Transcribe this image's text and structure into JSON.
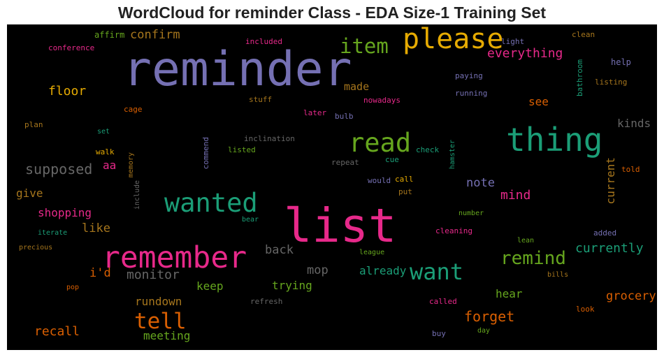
{
  "chart_data": {
    "type": "wordcloud",
    "title": "WordCloud for reminder Class - EDA Size-1 Training Set",
    "background": "#000000",
    "words": [
      {
        "text": "reminder",
        "color": "#7570b3"
      },
      {
        "text": "list",
        "color": "#e7298a"
      },
      {
        "text": "thing",
        "color": "#1b9e77"
      },
      {
        "text": "please",
        "color": "#e6ab02"
      },
      {
        "text": "remember",
        "color": "#e7298a"
      },
      {
        "text": "wanted",
        "color": "#1b9e77"
      },
      {
        "text": "read",
        "color": "#66a61e"
      },
      {
        "text": "want",
        "color": "#1b9e77"
      },
      {
        "text": "tell",
        "color": "#d95f02"
      },
      {
        "text": "item",
        "color": "#66a61e"
      },
      {
        "text": "remind",
        "color": "#66a61e"
      },
      {
        "text": "supposed",
        "color": "#666666"
      },
      {
        "text": "forget",
        "color": "#d95f02"
      },
      {
        "text": "currently",
        "color": "#1b9e77"
      },
      {
        "text": "grocery",
        "color": "#d95f02"
      },
      {
        "text": "everything",
        "color": "#e7298a"
      },
      {
        "text": "kinds",
        "color": "#666666"
      },
      {
        "text": "current",
        "color": "#a6761d"
      },
      {
        "text": "confirm",
        "color": "#a6761d"
      },
      {
        "text": "floor",
        "color": "#e6ab02"
      },
      {
        "text": "mind",
        "color": "#e7298a"
      },
      {
        "text": "note",
        "color": "#7570b3"
      },
      {
        "text": "recall",
        "color": "#d95f02"
      },
      {
        "text": "shopping",
        "color": "#e7298a"
      },
      {
        "text": "like",
        "color": "#a6761d"
      },
      {
        "text": "give",
        "color": "#a6761d"
      },
      {
        "text": "monitor",
        "color": "#666666"
      },
      {
        "text": "i'd",
        "color": "#d95f02"
      },
      {
        "text": "keep",
        "color": "#66a61e"
      },
      {
        "text": "rundown",
        "color": "#a6761d"
      },
      {
        "text": "meeting",
        "color": "#66a61e"
      },
      {
        "text": "back",
        "color": "#666666"
      },
      {
        "text": "mop",
        "color": "#666666"
      },
      {
        "text": "trying",
        "color": "#66a61e"
      },
      {
        "text": "already",
        "color": "#1b9e77"
      },
      {
        "text": "hear",
        "color": "#66a61e"
      },
      {
        "text": "see",
        "color": "#d95f02"
      },
      {
        "text": "made",
        "color": "#a6761d"
      },
      {
        "text": "aa",
        "color": "#e7298a"
      },
      {
        "text": "affirm",
        "color": "#66a61e"
      },
      {
        "text": "conference",
        "color": "#e7298a"
      },
      {
        "text": "included",
        "color": "#e7298a"
      },
      {
        "text": "light",
        "color": "#7570b3"
      },
      {
        "text": "clean",
        "color": "#a6761d"
      },
      {
        "text": "help",
        "color": "#7570b3"
      },
      {
        "text": "listing",
        "color": "#a6761d"
      },
      {
        "text": "paying",
        "color": "#7570b3"
      },
      {
        "text": "running",
        "color": "#7570b3"
      },
      {
        "text": "bathroom",
        "color": "#1b9e77"
      },
      {
        "text": "stuff",
        "color": "#a6761d"
      },
      {
        "text": "nowadays",
        "color": "#e7298a"
      },
      {
        "text": "later",
        "color": "#e7298a"
      },
      {
        "text": "bulb",
        "color": "#7570b3"
      },
      {
        "text": "cage",
        "color": "#d95f02"
      },
      {
        "text": "plan",
        "color": "#a6761d"
      },
      {
        "text": "set",
        "color": "#1b9e77"
      },
      {
        "text": "inclination",
        "color": "#666666"
      },
      {
        "text": "listed",
        "color": "#66a61e"
      },
      {
        "text": "check",
        "color": "#1b9e77"
      },
      {
        "text": "walk",
        "color": "#e6ab02"
      },
      {
        "text": "cue",
        "color": "#1b9e77"
      },
      {
        "text": "repeat",
        "color": "#666666"
      },
      {
        "text": "commend",
        "color": "#7570b3"
      },
      {
        "text": "memory",
        "color": "#a6761d"
      },
      {
        "text": "include",
        "color": "#666666"
      },
      {
        "text": "hamster",
        "color": "#1b9e77"
      },
      {
        "text": "told",
        "color": "#d95f02"
      },
      {
        "text": "call",
        "color": "#e6ab02"
      },
      {
        "text": "would",
        "color": "#7570b3"
      },
      {
        "text": "put",
        "color": "#a6761d"
      },
      {
        "text": "number",
        "color": "#66a61e"
      },
      {
        "text": "iterate",
        "color": "#1b9e77"
      },
      {
        "text": "bear",
        "color": "#1b9e77"
      },
      {
        "text": "cleaning",
        "color": "#e7298a"
      },
      {
        "text": "added",
        "color": "#7570b3"
      },
      {
        "text": "lean",
        "color": "#66a61e"
      },
      {
        "text": "precious",
        "color": "#a6761d"
      },
      {
        "text": "league",
        "color": "#66a61e"
      },
      {
        "text": "bills",
        "color": "#a6761d"
      },
      {
        "text": "pop",
        "color": "#d95f02"
      },
      {
        "text": "refresh",
        "color": "#666666"
      },
      {
        "text": "called",
        "color": "#e7298a"
      },
      {
        "text": "look",
        "color": "#d95f02"
      },
      {
        "text": "buy",
        "color": "#7570b3"
      },
      {
        "text": "day",
        "color": "#66a61e"
      }
    ]
  }
}
